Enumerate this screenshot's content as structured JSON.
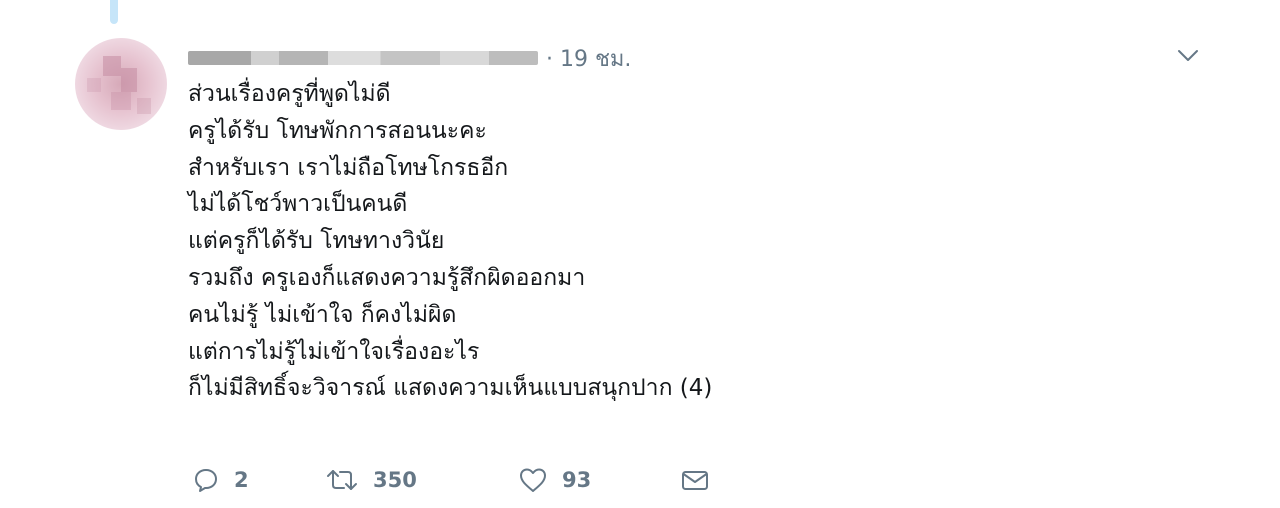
{
  "tweet": {
    "time": "· 19 ชม.",
    "lines": [
      "ส่วนเรื่องครูที่พูดไม่ดี",
      "ครูได้รับ โทษพักการสอนนะคะ",
      "สำหรับเรา เราไม่ถือโทษโกรธอีก",
      "ไม่ได้โชว์พาวเป็นคนดี",
      "แต่ครูก็ได้รับ โทษทางวินัย",
      "รวมถึง ครูเองก็แสดงความรู้สึกผิดออกมา",
      "คนไม่รู้ ไม่เข้าใจ ก็คงไม่ผิด",
      "แต่การไม่รู้ไม่เข้าใจเรื่องอะไร",
      "ก็ไม่มีสิทธิ์จะวิจารณ์ แสดงความเห็นแบบสนุกปาก (4)"
    ],
    "actions": {
      "reply_count": "2",
      "retweet_count": "350",
      "like_count": "93"
    }
  },
  "icons": {
    "reply": "reply-icon",
    "retweet": "retweet-icon",
    "like": "heart-icon",
    "message": "envelope-icon",
    "menu": "chevron-down-icon"
  },
  "colors": {
    "icon_gray": "#657786",
    "text": "#14171a",
    "thread_line": "#c6e5f9"
  }
}
